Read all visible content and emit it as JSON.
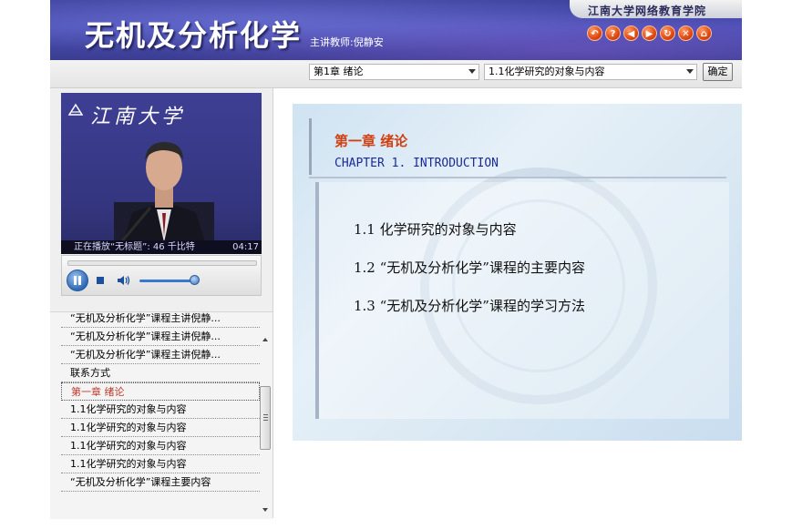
{
  "header": {
    "course_title": "无机及分析化学",
    "teacher": "主讲教师:倪静安",
    "school_name": "江南大学网络教育学院",
    "icons": [
      "back-icon",
      "help-icon",
      "prev-icon",
      "next-icon",
      "refresh-icon",
      "close-icon",
      "home-icon"
    ]
  },
  "nav": {
    "chapter_select": "第1章  绪论",
    "section_select": "1.1化学研究的对象与内容",
    "confirm_label": "确定"
  },
  "player": {
    "video_logo": "江南大学",
    "now_playing": "正在播放“无标题”: 46 千比特",
    "time": "04:17"
  },
  "playlist": {
    "items": [
      "“无机及分析化学”课程主讲倪静...",
      "“无机及分析化学”课程主讲倪静...",
      "“无机及分析化学”课程主讲倪静...",
      "联系方式",
      "第一章 绪论",
      "1.1化学研究的对象与内容",
      "1.1化学研究的对象与内容",
      "1.1化学研究的对象与内容",
      "1.1化学研究的对象与内容",
      "“无机及分析化学”课程主要内容"
    ],
    "active_index": 4
  },
  "content": {
    "chapter_cn": "第一章  绪论",
    "chapter_en": "CHAPTER 1. INTRODUCTION",
    "toc": [
      "1.1  化学研究的对象与内容",
      "1.2  “无机及分析化学”课程的主要内容",
      "1.3  “无机及分析化学”课程的学习方法"
    ]
  },
  "colors": {
    "header_bg": "#3c3f9c",
    "chapter_heading": "#d04012",
    "chapter_en": "#1a2a9a",
    "active_item": "#c0392b",
    "icon_orange": "#e0480f"
  }
}
